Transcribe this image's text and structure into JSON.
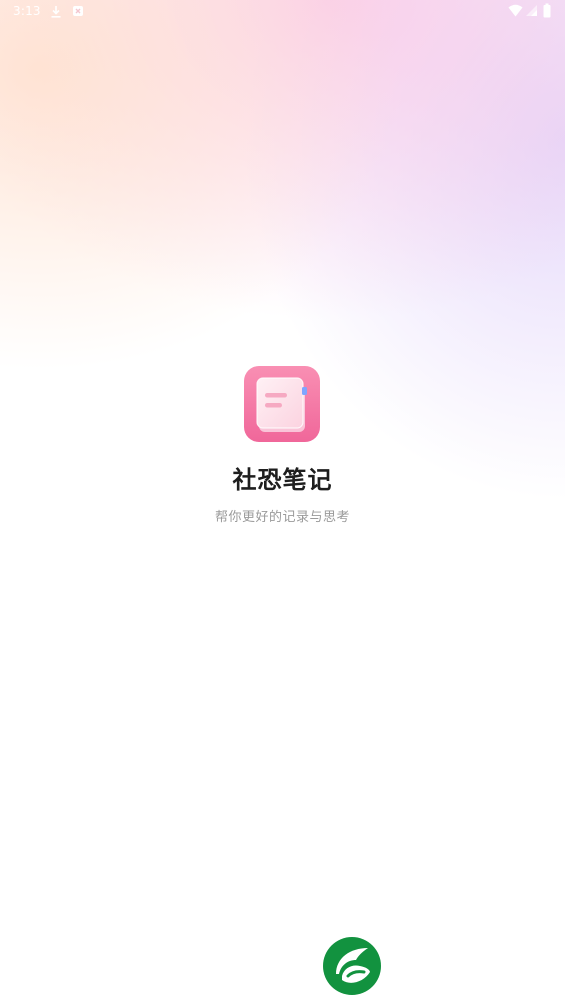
{
  "status_bar": {
    "time": "3:13",
    "icons": [
      "download-icon",
      "notification-app-icon",
      "wifi-icon",
      "cellular-signal-icon",
      "battery-icon"
    ]
  },
  "splash": {
    "app_icon": "notebook-app-icon",
    "app_name": "社恐笔记",
    "tagline": "帮你更好的记录与思考",
    "brand_logo": "green-leaf-logo-icon"
  },
  "colors": {
    "icon_pink_top": "#f98fb3",
    "icon_pink_bottom": "#f0679a",
    "logo_green": "#12923f",
    "title_text": "#1e1e1e",
    "subtitle_text": "#9a9a9a"
  }
}
